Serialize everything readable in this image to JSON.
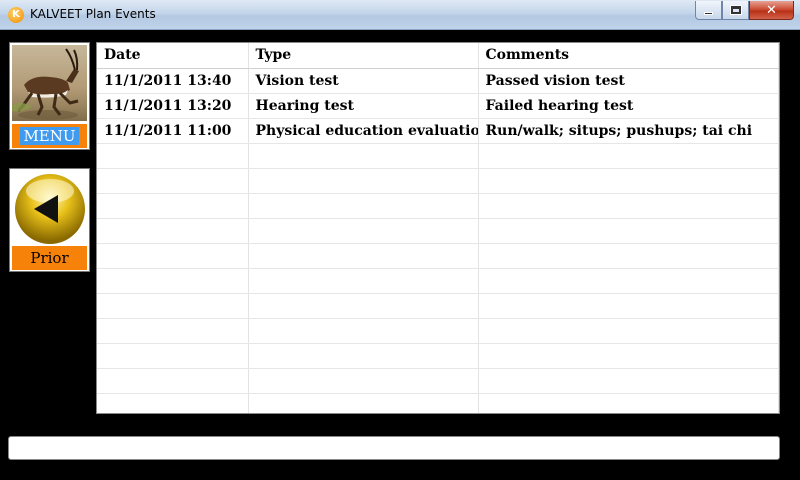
{
  "window": {
    "title": "KALVEET Plan Events",
    "app_icon_letter": "K",
    "close_glyph": "✕"
  },
  "sidebar": {
    "menu_label": "MENU",
    "prior_label": "Prior"
  },
  "grid": {
    "columns": [
      "Date",
      "Type",
      "Comments"
    ],
    "rows": [
      [
        "11/1/2011 13:40",
        "Vision test",
        "Passed vision test"
      ],
      [
        "11/1/2011 13:20",
        "Hearing test",
        "Failed hearing test"
      ],
      [
        "11/1/2011 11:00",
        "Physical education evaluation",
        "Run/walk; situps; pushups; tai chi"
      ],
      [
        "",
        "",
        ""
      ],
      [
        "",
        "",
        ""
      ],
      [
        "",
        "",
        ""
      ],
      [
        "",
        "",
        ""
      ],
      [
        "",
        "",
        ""
      ],
      [
        "",
        "",
        ""
      ],
      [
        "",
        "",
        ""
      ],
      [
        "",
        "",
        ""
      ],
      [
        "",
        "",
        ""
      ],
      [
        "",
        "",
        ""
      ],
      [
        "",
        "",
        ""
      ]
    ]
  },
  "icons": {
    "menu_image": "antelope-photo-icon",
    "prior_image": "back-arrow-orb-icon"
  },
  "colors": {
    "label_orange": "#f7820a",
    "menu_highlight": "#3e9bf0"
  }
}
